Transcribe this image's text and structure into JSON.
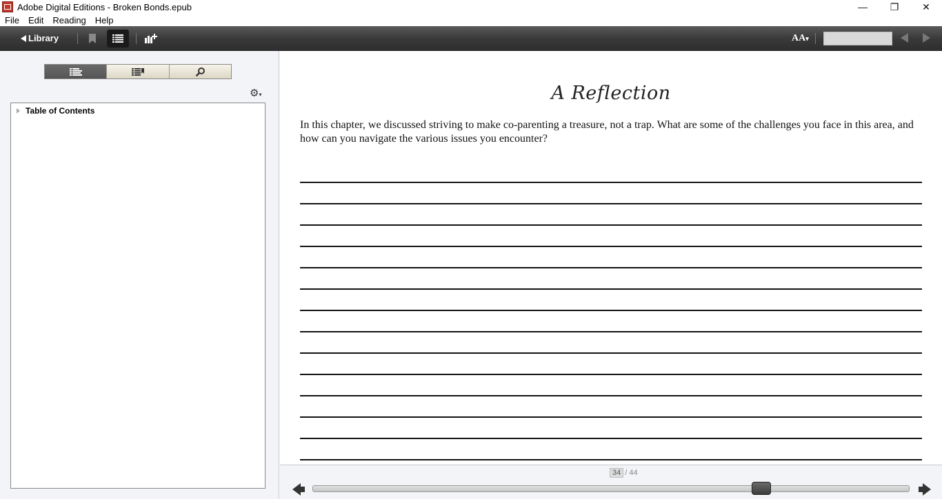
{
  "window": {
    "title": "Adobe Digital Editions - Broken Bonds.epub",
    "minimize_glyph": "—",
    "restore_glyph": "❐",
    "close_glyph": "✕"
  },
  "menu": {
    "items": [
      "File",
      "Edit",
      "Reading",
      "Help"
    ]
  },
  "toolbar": {
    "library_label": "Library",
    "font_size_label": "AA",
    "search_value": ""
  },
  "sidebar": {
    "tabs": [
      "toc-list-icon",
      "bookmarks-list-icon",
      "search-icon"
    ],
    "active_tab": 0,
    "toc_title": "Table of Contents"
  },
  "reader": {
    "chapter_title": "A Reflection",
    "body": "In this chapter, we discussed striving to make co-parenting a treasure, not a trap. What are some of the challenges you face in this area, and how can you navigate the various issues you encounter?",
    "writing_line_count": 14
  },
  "pagination": {
    "current_page": "34",
    "total_pages": "/ 44",
    "progress_fraction": 0.76
  },
  "colors": {
    "toolbar_dark": "#3a3a3a",
    "sidebar_bg": "#f2f4f7",
    "active_tab": "#555555"
  }
}
